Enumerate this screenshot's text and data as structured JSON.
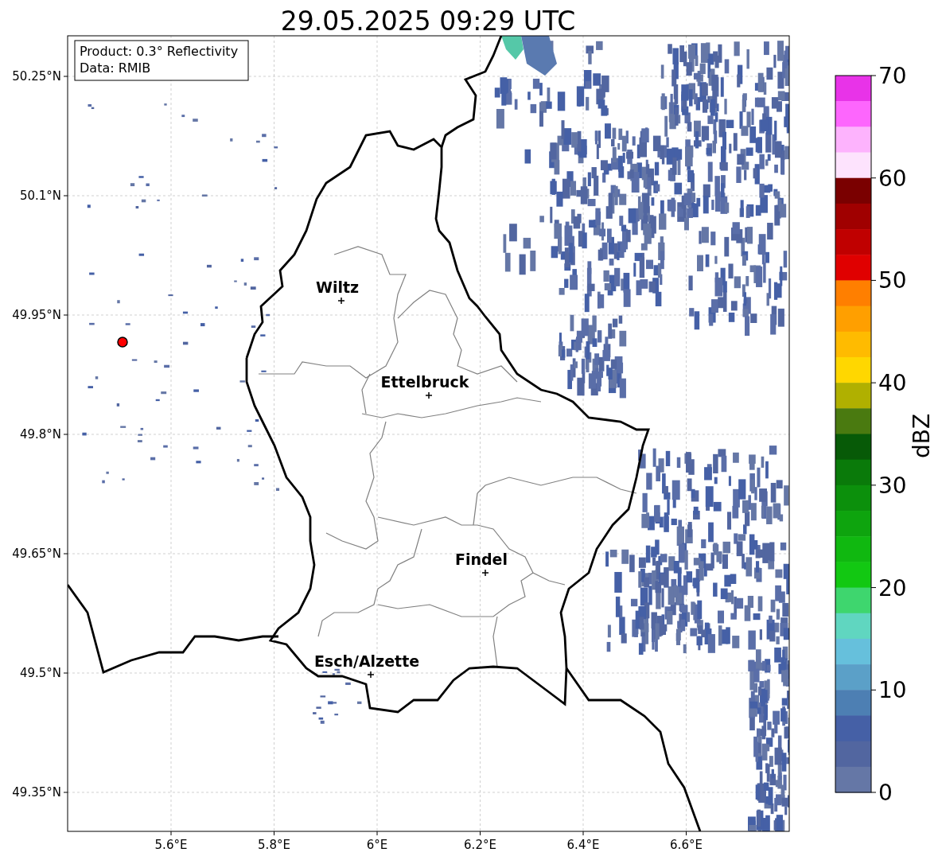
{
  "title": "29.05.2025 09:29 UTC",
  "info_box": {
    "lines": [
      "Product: 0.3° Reflectivity",
      "Data: RMIB"
    ]
  },
  "map": {
    "lat_labels": [
      "50.25°N",
      "50.1°N",
      "49.95°N",
      "49.8°N",
      "49.65°N",
      "49.5°N",
      "49.35°N"
    ],
    "lon_labels": [
      "5.6°E",
      "5.8°E",
      "6°E",
      "6.2°E",
      "6.4°E",
      "6.6°E"
    ],
    "cities": [
      {
        "label": "Wiltz"
      },
      {
        "label": "Ettelbruck"
      },
      {
        "label": "Findel"
      },
      {
        "label": "Esch/Alzette"
      }
    ]
  },
  "colorbar": {
    "label": "dBZ",
    "ticks": [
      "70",
      "60",
      "50",
      "40",
      "30",
      "20",
      "10",
      "0"
    ],
    "bins": [
      {
        "color": "#e833e8"
      },
      {
        "color": "#fd66fd"
      },
      {
        "color": "#fdb3fd"
      },
      {
        "color": "#fde3fd"
      },
      {
        "color": "#7a0000"
      },
      {
        "color": "#a00000"
      },
      {
        "color": "#c00000"
      },
      {
        "color": "#e00000"
      },
      {
        "color": "#ff7f00"
      },
      {
        "color": "#ff9f00"
      },
      {
        "color": "#ffbb00"
      },
      {
        "color": "#ffd700"
      },
      {
        "color": "#b0b000"
      },
      {
        "color": "#4a7a10"
      },
      {
        "color": "#075a07"
      },
      {
        "color": "#0a7a0a"
      },
      {
        "color": "#0c900c"
      },
      {
        "color": "#0ea40e"
      },
      {
        "color": "#10b810"
      },
      {
        "color": "#12c812"
      },
      {
        "color": "#3ed66e"
      },
      {
        "color": "#60d6c0"
      },
      {
        "color": "#66c0dc"
      },
      {
        "color": "#5ba0c8"
      },
      {
        "color": "#4d7fb3"
      },
      {
        "color": "#4560a6"
      },
      {
        "color": "#5266a0"
      },
      {
        "color": "#6577a6"
      }
    ]
  }
}
